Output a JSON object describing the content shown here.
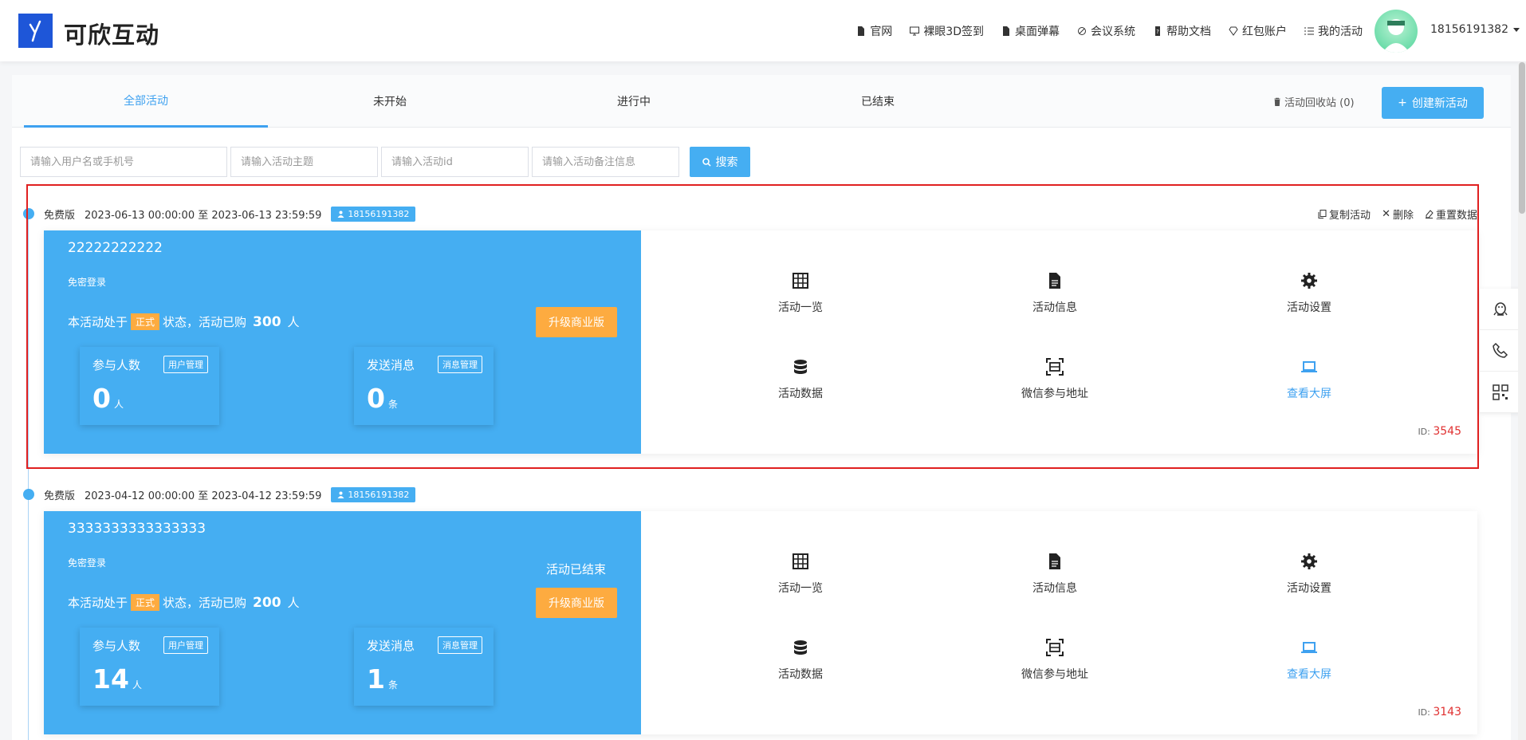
{
  "brand": {
    "name": "可欣互动"
  },
  "nav": [
    {
      "label": "官网",
      "icon": "document-icon"
    },
    {
      "label": "裸眼3D签到",
      "icon": "monitor-icon"
    },
    {
      "label": "桌面弹幕",
      "icon": "document-icon"
    },
    {
      "label": "会议系统",
      "icon": "share-icon"
    },
    {
      "label": "帮助文档",
      "icon": "help-icon"
    },
    {
      "label": "红包账户",
      "icon": "diamond-icon"
    },
    {
      "label": "我的活动",
      "icon": "list-icon"
    }
  ],
  "user": {
    "phone": "18156191382"
  },
  "tabs": [
    "全部活动",
    "未开始",
    "进行中",
    "已结束"
  ],
  "recycle": "活动回收站 (0)",
  "create_button": "创建新活动",
  "search": {
    "user_placeholder": "请输入用户名或手机号",
    "topic_placeholder": "请输入活动主题",
    "id_placeholder": "请输入活动id",
    "note_placeholder": "请输入活动备注信息",
    "button": "搜索"
  },
  "actions": {
    "copy": "复制活动",
    "delete": "删除",
    "reset": "重置数据"
  },
  "labels": {
    "no_password": "免密登录",
    "status_prefix": "本活动处于",
    "formal": "正式",
    "status_mid": "状态，活动已购",
    "people_unit": "人",
    "upgrade": "升级商业版",
    "participants": "参与人数",
    "user_manage": "用户管理",
    "messages": "发送消息",
    "message_manage": "消息管理",
    "msg_unit": "条",
    "person_unit": "人",
    "id_prefix": "ID:"
  },
  "functions": [
    "活动一览",
    "活动信息",
    "活动设置",
    "活动数据",
    "微信参与地址",
    "查看大屏"
  ],
  "activities": [
    {
      "edition": "免费版",
      "time": "2023-06-13 00:00:00 至 2023-06-13 23:59:59",
      "owner": "18156191382",
      "name": "22222222222",
      "purchased": "300",
      "participants": "0",
      "messages": "0",
      "ended_text": "",
      "id": "3545"
    },
    {
      "edition": "免费版",
      "time": "2023-04-12 00:00:00 至 2023-04-12 23:59:59",
      "owner": "18156191382",
      "name": "3333333333333333",
      "purchased": "200",
      "participants": "14",
      "messages": "1",
      "ended_text": "活动已结束",
      "id": "3143"
    }
  ],
  "colors": {
    "primary": "#45aef2",
    "orange": "#fdab40",
    "red_id": "#e03030",
    "logo_blue": "#1e56d8"
  }
}
